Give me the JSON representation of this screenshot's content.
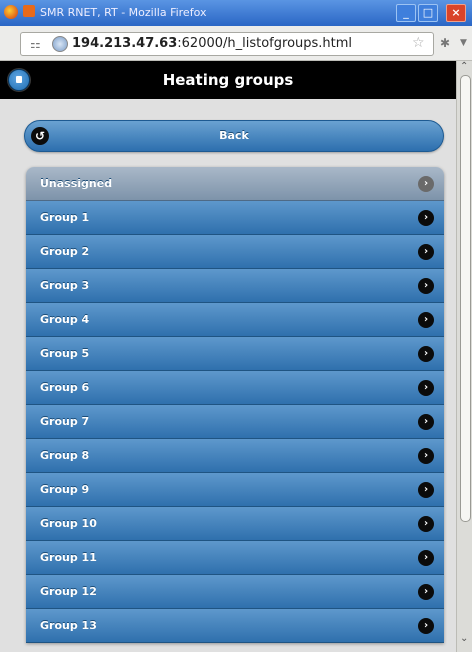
{
  "window": {
    "title": "SMR RNET, RT - Mozilla Firefox",
    "min_label": "_",
    "max_label": "□",
    "close_label": "×"
  },
  "browser": {
    "url_host": "194.213.47.63",
    "url_rest": ":62000/h_listofgroups.html"
  },
  "page": {
    "title": "Heating groups",
    "back_label": "Back"
  },
  "groups": [
    "Unassigned",
    "Group 1",
    "Group 2",
    "Group 3",
    "Group 4",
    "Group 5",
    "Group 6",
    "Group 7",
    "Group 8",
    "Group 9",
    "Group 10",
    "Group 11",
    "Group 12",
    "Group 13"
  ],
  "icons": {
    "home": "home-icon",
    "back": "back-arrow-icon",
    "chevron": "chevron-right-icon"
  }
}
